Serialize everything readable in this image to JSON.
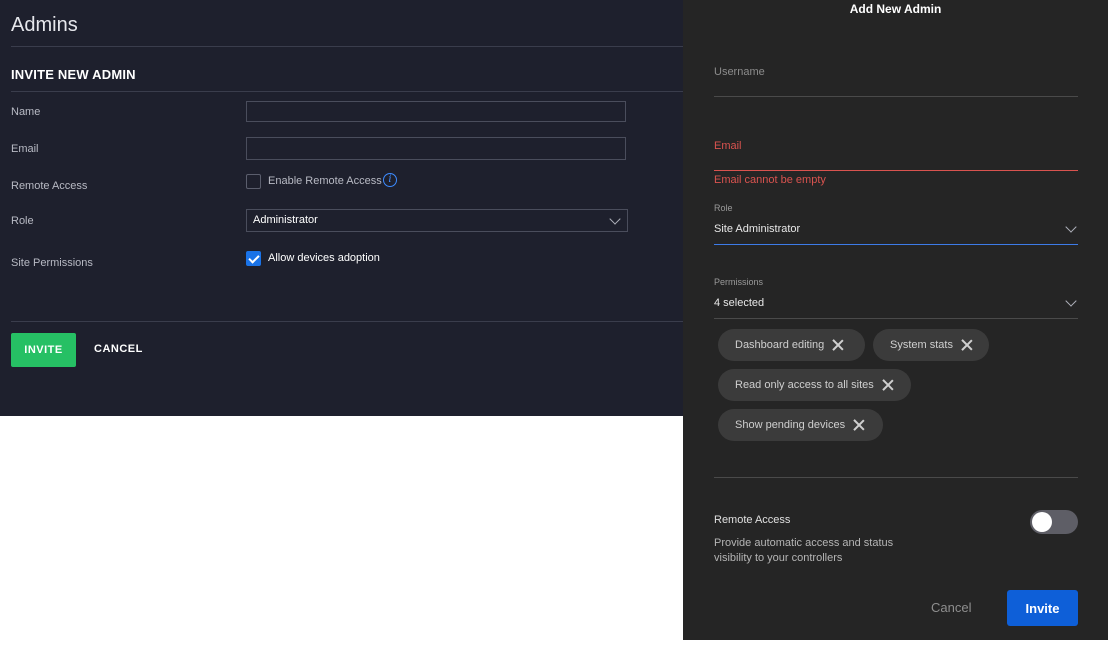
{
  "admins_page": {
    "title": "Admins",
    "section_title": "INVITE NEW ADMIN",
    "labels": {
      "name": "Name",
      "email": "Email",
      "remote_access": "Remote Access",
      "role": "Role",
      "site_permissions": "Site Permissions"
    },
    "name_value": "",
    "email_value": "",
    "enable_remote_access_label": "Enable Remote Access",
    "enable_remote_access_checked": false,
    "role_value": "Administrator",
    "allow_devices_adoption_label": "Allow devices adoption",
    "allow_devices_adoption_checked": true,
    "invite_label": "INVITE",
    "cancel_label": "CANCEL",
    "colors": {
      "accent_green": "#26c064",
      "checkbox_blue": "#1a73e8",
      "background": "#1e202d"
    }
  },
  "drawer": {
    "title": "Add New Admin",
    "username_placeholder": "Username",
    "email_placeholder": "Email",
    "email_error": "Email cannot be empty",
    "role_label": "Role",
    "role_value": "Site Administrator",
    "permissions_label": "Permissions",
    "permissions_value": "4 selected",
    "permission_chips": [
      {
        "label": "Dashboard editing"
      },
      {
        "label": "System stats"
      },
      {
        "label": "Read only access to all sites"
      },
      {
        "label": "Show pending devices"
      }
    ],
    "remote_access_title": "Remote Access",
    "remote_access_description": "Provide automatic access and status visibility to your controllers",
    "remote_access_enabled": false,
    "cancel_label": "Cancel",
    "invite_label": "Invite",
    "colors": {
      "error_red": "#d9534f",
      "primary_blue": "#0e5fd8",
      "background": "#252525"
    }
  }
}
